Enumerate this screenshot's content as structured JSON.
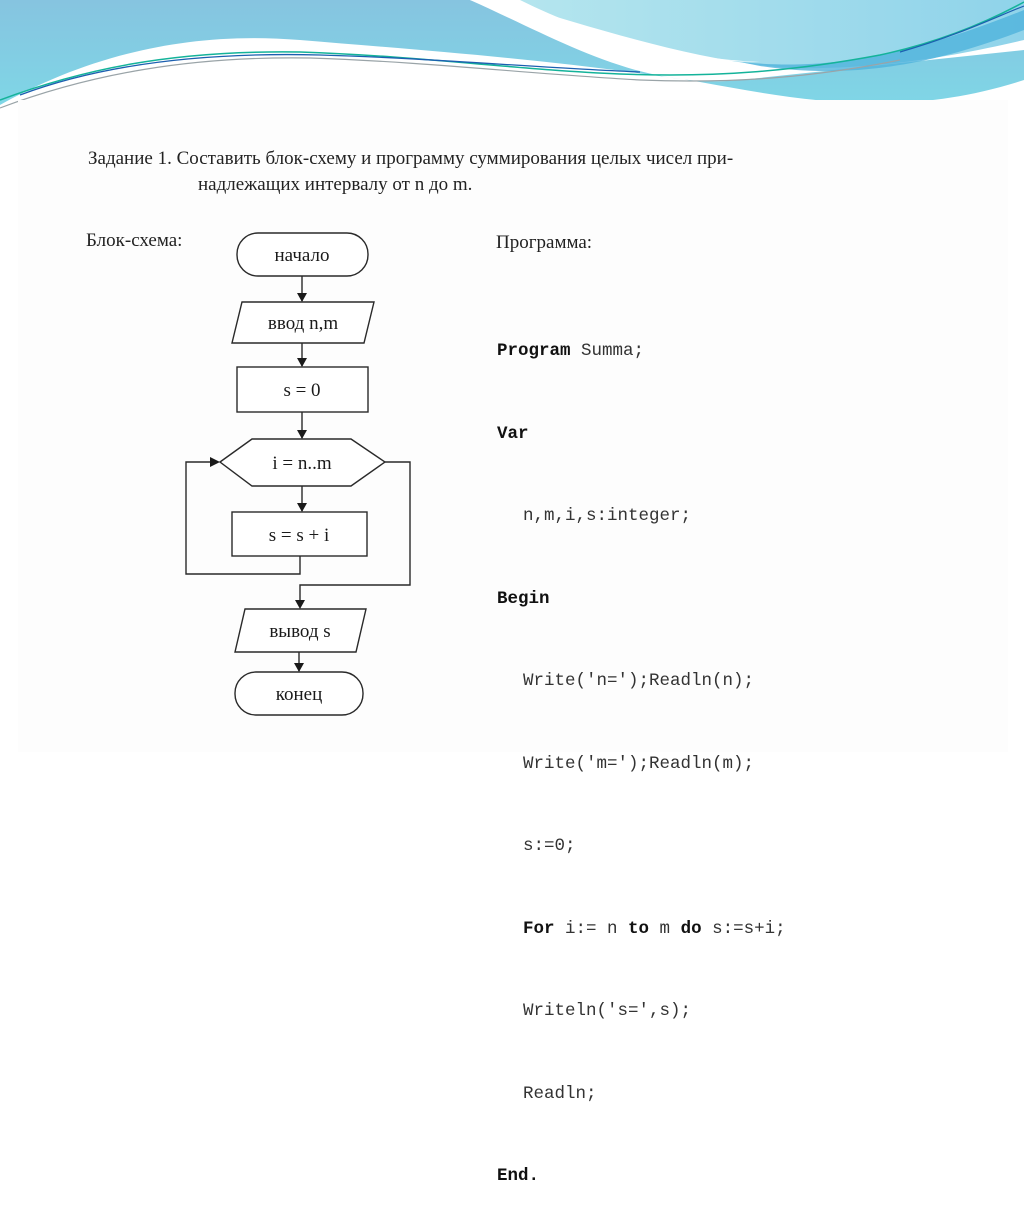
{
  "slide": {
    "task": {
      "line1": "Задание 1. Составить блок-схему и программу суммирования целых чисел при-",
      "line2": "надлежащих интервалу от n до m."
    },
    "flowchart_label": "Блок-схема:",
    "program_label": "Программа:"
  },
  "flowchart": {
    "start": "начало",
    "input": "ввод n,m",
    "init": "s = 0",
    "loop": "i = n..m",
    "body": "s = s + i",
    "output": "вывод s",
    "end": "конец"
  },
  "program": {
    "lines": [
      {
        "kw": "Program",
        "rest": " Summa;",
        "indent": false
      },
      {
        "kw": "Var",
        "rest": "",
        "indent": false
      },
      {
        "kw": "",
        "rest": "n,m,i,s:integer;",
        "indent": true
      },
      {
        "kw": "Begin",
        "rest": "",
        "indent": false
      },
      {
        "kw": "",
        "rest": "Write('n=');Readln(n);",
        "indent": true
      },
      {
        "kw": "",
        "rest": "Write('m=');Readln(m);",
        "indent": true
      },
      {
        "kw": "",
        "rest": "s:=0;",
        "indent": true
      },
      {
        "kw": "For",
        "rest": " i:= n ",
        "kw2": "to",
        "rest2": " m ",
        "kw3": "do",
        "rest3": " s:=s+i;",
        "indent": true
      },
      {
        "kw": "",
        "rest": "Writeln('s=',s);",
        "indent": true
      },
      {
        "kw": "",
        "rest": "Readln;",
        "indent": true
      },
      {
        "kw": "End",
        "rest": ".",
        "indent": false
      }
    ]
  },
  "colors": {
    "wave_light": "#a9dde9",
    "wave_mid": "#6cc8de",
    "wave_deep": "#3aa9d3",
    "line_teal": "#14b39a",
    "line_blue": "#1c5fb0"
  }
}
